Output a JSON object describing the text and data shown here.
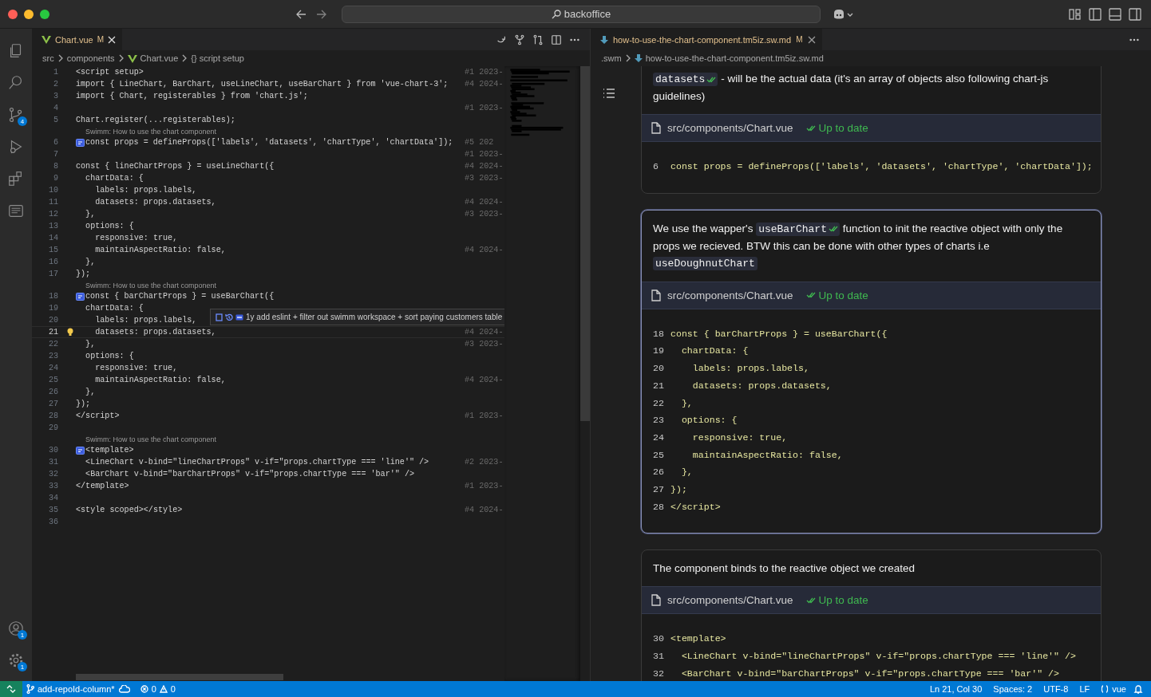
{
  "title_bar": {
    "search": "backoffice"
  },
  "activity_bar": {
    "top": [
      {
        "kind": "files"
      },
      {
        "kind": "search"
      },
      {
        "kind": "source-control",
        "badge": "4"
      },
      {
        "kind": "run-debug"
      },
      {
        "kind": "extensions"
      },
      {
        "kind": "notes"
      }
    ],
    "bottom": [
      {
        "kind": "accounts",
        "badge": "1"
      },
      {
        "kind": "settings",
        "badge": "1"
      }
    ]
  },
  "left_editor": {
    "tab": {
      "label": "Chart.vue",
      "status": "M"
    },
    "breadcrumb": [
      {
        "label": "src",
        "kind": "folder"
      },
      {
        "label": "components",
        "kind": "folder"
      },
      {
        "label": "Chart.vue",
        "kind": "vue"
      },
      {
        "label": "{} script setup",
        "kind": "symbol"
      }
    ],
    "lines": [
      {
        "kind": "code",
        "number": "1",
        "code": "<script setup>",
        "blame": "#1 2023-",
        "current": false
      },
      {
        "kind": "code",
        "number": "2",
        "code": "import { LineChart, BarChart, useLineChart, useBarChart } from 'vue-chart-3';",
        "blame": "#4 2024-",
        "current": false
      },
      {
        "kind": "code",
        "number": "3",
        "code": "import { Chart, registerables } from 'chart.js';",
        "current": false
      },
      {
        "kind": "code",
        "number": "4",
        "blame": "#1 2023-",
        "current": false
      },
      {
        "kind": "code",
        "number": "5",
        "code": "Chart.register(...registerables);",
        "current": false
      },
      {
        "kind": "lens",
        "text": "Swimm: How to use the chart component"
      },
      {
        "kind": "code",
        "number": "6",
        "code": "const props = defineProps(['labels', 'datasets', 'chartType', 'chartData']);",
        "blame": "#5 202",
        "current": false
      },
      {
        "kind": "code",
        "number": "7",
        "blame": "#1 2023-",
        "current": false
      },
      {
        "kind": "code",
        "number": "8",
        "code": "const { lineChartProps } = useLineChart({",
        "blame": "#4 2024-",
        "current": false
      },
      {
        "kind": "code",
        "number": "9",
        "code": "  chartData: {",
        "blame": "#3 2023-",
        "current": false
      },
      {
        "kind": "code",
        "number": "10",
        "code": "    labels: props.labels,",
        "current": false
      },
      {
        "kind": "code",
        "number": "11",
        "code": "    datasets: props.datasets,",
        "blame": "#4 2024-",
        "current": false
      },
      {
        "kind": "code",
        "number": "12",
        "code": "  },",
        "blame": "#3 2023-",
        "current": false
      },
      {
        "kind": "code",
        "number": "13",
        "code": "  options: {",
        "current": false
      },
      {
        "kind": "code",
        "number": "14",
        "code": "    responsive: true,",
        "current": false
      },
      {
        "kind": "code",
        "number": "15",
        "code": "    maintainAspectRatio: false,",
        "blame": "#4 2024-",
        "current": false
      },
      {
        "kind": "code",
        "number": "16",
        "code": "  },",
        "current": false
      },
      {
        "kind": "code",
        "number": "17",
        "code": "});",
        "current": false
      },
      {
        "kind": "lens",
        "text": "Swimm: How to use the chart component"
      },
      {
        "kind": "code",
        "number": "18",
        "code": "const { barChartProps } = useBarChart({",
        "current": false
      },
      {
        "kind": "code",
        "number": "19",
        "code": "  chartData: {",
        "current": false
      },
      {
        "kind": "code",
        "number": "20",
        "code": "    labels: props.labels,",
        "current": false,
        "hover": "1y add eslint + filter out swimm workspace + sort paying customers table"
      },
      {
        "kind": "code",
        "number": "21",
        "code": "    datasets: props.datasets,",
        "blame": "#4 2024-",
        "current": true
      },
      {
        "kind": "code",
        "number": "22",
        "code": "  },",
        "blame": "#3 2023-",
        "current": false
      },
      {
        "kind": "code",
        "number": "23",
        "code": "  options: {",
        "current": false
      },
      {
        "kind": "code",
        "number": "24",
        "code": "    responsive: true,",
        "current": false
      },
      {
        "kind": "code",
        "number": "25",
        "code": "    maintainAspectRatio: false,",
        "blame": "#4 2024-",
        "current": false
      },
      {
        "kind": "code",
        "number": "26",
        "code": "  },",
        "current": false
      },
      {
        "kind": "code",
        "number": "27",
        "code": "});",
        "current": false
      },
      {
        "kind": "code",
        "number": "28",
        "code": "</script>",
        "blame": "#1 2023-",
        "current": false
      },
      {
        "kind": "code",
        "number": "29",
        "current": false
      },
      {
        "kind": "lens",
        "text": "Swimm: How to use the chart component"
      },
      {
        "kind": "code",
        "number": "30",
        "code": "<template>",
        "current": false
      },
      {
        "kind": "code",
        "number": "31",
        "code": "  <LineChart v-bind=\"lineChartProps\" v-if=\"props.chartType === 'line'\" />",
        "blame": "#2 2023-",
        "current": false
      },
      {
        "kind": "code",
        "number": "32",
        "code": "  <BarChart v-bind=\"barChartProps\" v-if=\"props.chartType === 'bar'\" />",
        "current": false
      },
      {
        "kind": "code",
        "number": "33",
        "code": "</template>",
        "blame": "#1 2023-",
        "current": false
      },
      {
        "kind": "code",
        "number": "34",
        "current": false
      },
      {
        "kind": "code",
        "number": "35",
        "code": "<style scoped></style>",
        "blame": "#4 2024-",
        "current": false
      },
      {
        "kind": "code",
        "number": "36",
        "current": false
      }
    ]
  },
  "right_editor": {
    "tab": {
      "label": "how-to-use-the-chart-component.tm5iz.sw.md",
      "status": "M"
    },
    "breadcrumb": [
      {
        "label": ".swm",
        "kind": "folder"
      },
      {
        "label": "how-to-use-the-chart-component.tm5iz.sw.md",
        "kind": "markdown"
      }
    ],
    "cards": [
      {
        "selected": false,
        "text": [
          {
            "kind": "code",
            "text": "datasets",
            "verified": true
          },
          {
            "kind": "text",
            "text": " - will be the actual data (it's an array of objects also following chart-js guidelines)"
          }
        ],
        "file": "src/components/Chart.vue",
        "status": "Up to date",
        "code": [
          {
            "number": "6",
            "code": "const props = defineProps(['labels', 'datasets', 'chartType', 'chartData']);"
          }
        ]
      },
      {
        "selected": true,
        "text": [
          {
            "kind": "text",
            "text": "We use the wapper's "
          },
          {
            "kind": "code",
            "text": "useBarChart",
            "verified": true
          },
          {
            "kind": "text",
            "text": " function to init the reactive object with only the props we recieved. BTW this can be done with other types of charts i.e "
          },
          {
            "kind": "code",
            "text": "useDoughnutChart",
            "verified": false
          }
        ],
        "file": "src/components/Chart.vue",
        "status": "Up to date",
        "code": [
          {
            "number": "18",
            "code": "const { barChartProps } = useBarChart({"
          },
          {
            "number": "19",
            "code": "  chartData: {"
          },
          {
            "number": "20",
            "code": "    labels: props.labels,"
          },
          {
            "number": "21",
            "code": "    datasets: props.datasets,"
          },
          {
            "number": "22",
            "code": "  },"
          },
          {
            "number": "23",
            "code": "  options: {"
          },
          {
            "number": "24",
            "code": "    responsive: true,"
          },
          {
            "number": "25",
            "code": "    maintainAspectRatio: false,"
          },
          {
            "number": "26",
            "code": "  },"
          },
          {
            "number": "27",
            "code": "});"
          },
          {
            "number": "28",
            "code": "</script>"
          }
        ]
      },
      {
        "selected": false,
        "text": [
          {
            "kind": "text",
            "text": "The component binds to the reactive object we created"
          }
        ],
        "file": "src/components/Chart.vue",
        "status": "Up to date",
        "code": [
          {
            "number": "30",
            "code": "<template>"
          },
          {
            "number": "31",
            "code": "  <LineChart v-bind=\"lineChartProps\" v-if=\"props.chartType === 'line'\" />"
          },
          {
            "number": "32",
            "code": "  <BarChart v-bind=\"barChartProps\" v-if=\"props.chartType === 'bar'\" />"
          }
        ]
      }
    ]
  },
  "status_bar": {
    "branch": "add-repoId-column*",
    "errors": "0",
    "warnings": "0",
    "items": [
      "Ln 21, Col 30",
      "Spaces: 2",
      "UTF-8",
      "LF"
    ],
    "language": "vue"
  }
}
